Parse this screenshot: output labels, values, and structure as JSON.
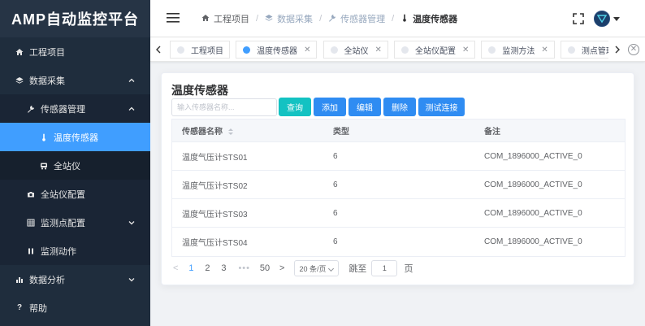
{
  "app": {
    "title": "AMP自动监控平台"
  },
  "sidebar": {
    "items": [
      {
        "label": "工程项目",
        "icon": "home-icon"
      },
      {
        "label": "数据采集",
        "icon": "layers-icon"
      },
      {
        "label": "传感器管理",
        "icon": "wrench-icon"
      },
      {
        "label": "温度传感器",
        "icon": "thermometer-icon"
      },
      {
        "label": "全站仪",
        "icon": "device-icon"
      },
      {
        "label": "全站仪配置",
        "icon": "camera-icon"
      },
      {
        "label": "监测点配置",
        "icon": "grid-icon"
      },
      {
        "label": "监测动作",
        "icon": "pause-icon"
      },
      {
        "label": "数据分析",
        "icon": "bar-chart-icon"
      },
      {
        "label": "帮助",
        "icon": "question-icon"
      }
    ]
  },
  "header": {
    "breadcrumb": [
      {
        "label": "工程项目"
      },
      {
        "label": "数据采集"
      },
      {
        "label": "传感器管理"
      },
      {
        "label": "温度传感器"
      }
    ]
  },
  "tags": [
    {
      "label": "工程项目"
    },
    {
      "label": "温度传感器"
    },
    {
      "label": "全站仪"
    },
    {
      "label": "全站仪配置"
    },
    {
      "label": "监测方法"
    },
    {
      "label": "测点管理"
    }
  ],
  "main": {
    "title": "温度传感器",
    "search_placeholder": "输入传感器名称...",
    "buttons": {
      "query": "查询",
      "add": "添加",
      "edit": "编辑",
      "delete": "删除",
      "test": "测试连接"
    },
    "table": {
      "columns": [
        "传感器名称",
        "类型",
        "备注"
      ],
      "rows": [
        {
          "name": "温度气压计STS01",
          "type": "6",
          "note": "COM_1896000_ACTIVE_0"
        },
        {
          "name": "温度气压计STS02",
          "type": "6",
          "note": "COM_1896000_ACTIVE_0"
        },
        {
          "name": "温度气压计STS03",
          "type": "6",
          "note": "COM_1896000_ACTIVE_0"
        },
        {
          "name": "温度气压计STS04",
          "type": "6",
          "note": "COM_1896000_ACTIVE_0"
        }
      ]
    },
    "pagination": {
      "pages": [
        "1",
        "2",
        "3"
      ],
      "more": "•••",
      "last": "50",
      "page_size": "20 条/页",
      "goto_label": "跳至",
      "goto_value": "1",
      "page_unit": "页"
    }
  },
  "colors": {
    "sidebar_bg": "#1f2d3d",
    "accent": "#409eff",
    "query_btn": "#13c2c2"
  }
}
